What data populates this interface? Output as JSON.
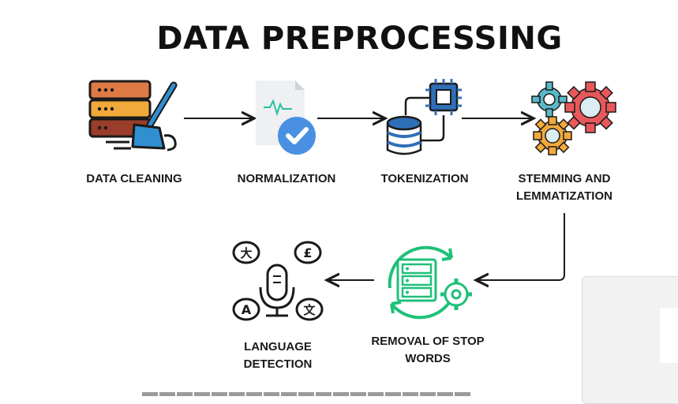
{
  "title": "DATA PREPROCESSING",
  "steps": [
    {
      "label": "DATA CLEANING",
      "icon": "server-broom-icon"
    },
    {
      "label": "NORMALIZATION",
      "icon": "document-check-icon"
    },
    {
      "label": "TOKENIZATION",
      "icon": "database-chip-icon"
    },
    {
      "label_line1": "STEMMING AND",
      "label_line2": "LEMMATIZATION",
      "icon": "gears-icon"
    },
    {
      "label_line1": "REMOVAL OF STOP",
      "label_line2": "WORDS",
      "icon": "list-cycle-gear-icon"
    },
    {
      "label_line1": "LANGUAGE",
      "label_line2": "DETECTION",
      "icon": "microphone-languages-icon"
    }
  ],
  "colors": {
    "server_top": "#e07a45",
    "server_mid": "#f2a93b",
    "server_bot": "#9a3d2a",
    "broom": "#2f8fcf",
    "check": "#4a90e2",
    "chip": "#2f6fb8",
    "gear_teal": "#5ab9c9",
    "gear_red": "#e8585b",
    "gear_orange": "#f2a93b",
    "green": "#1fc07a"
  }
}
